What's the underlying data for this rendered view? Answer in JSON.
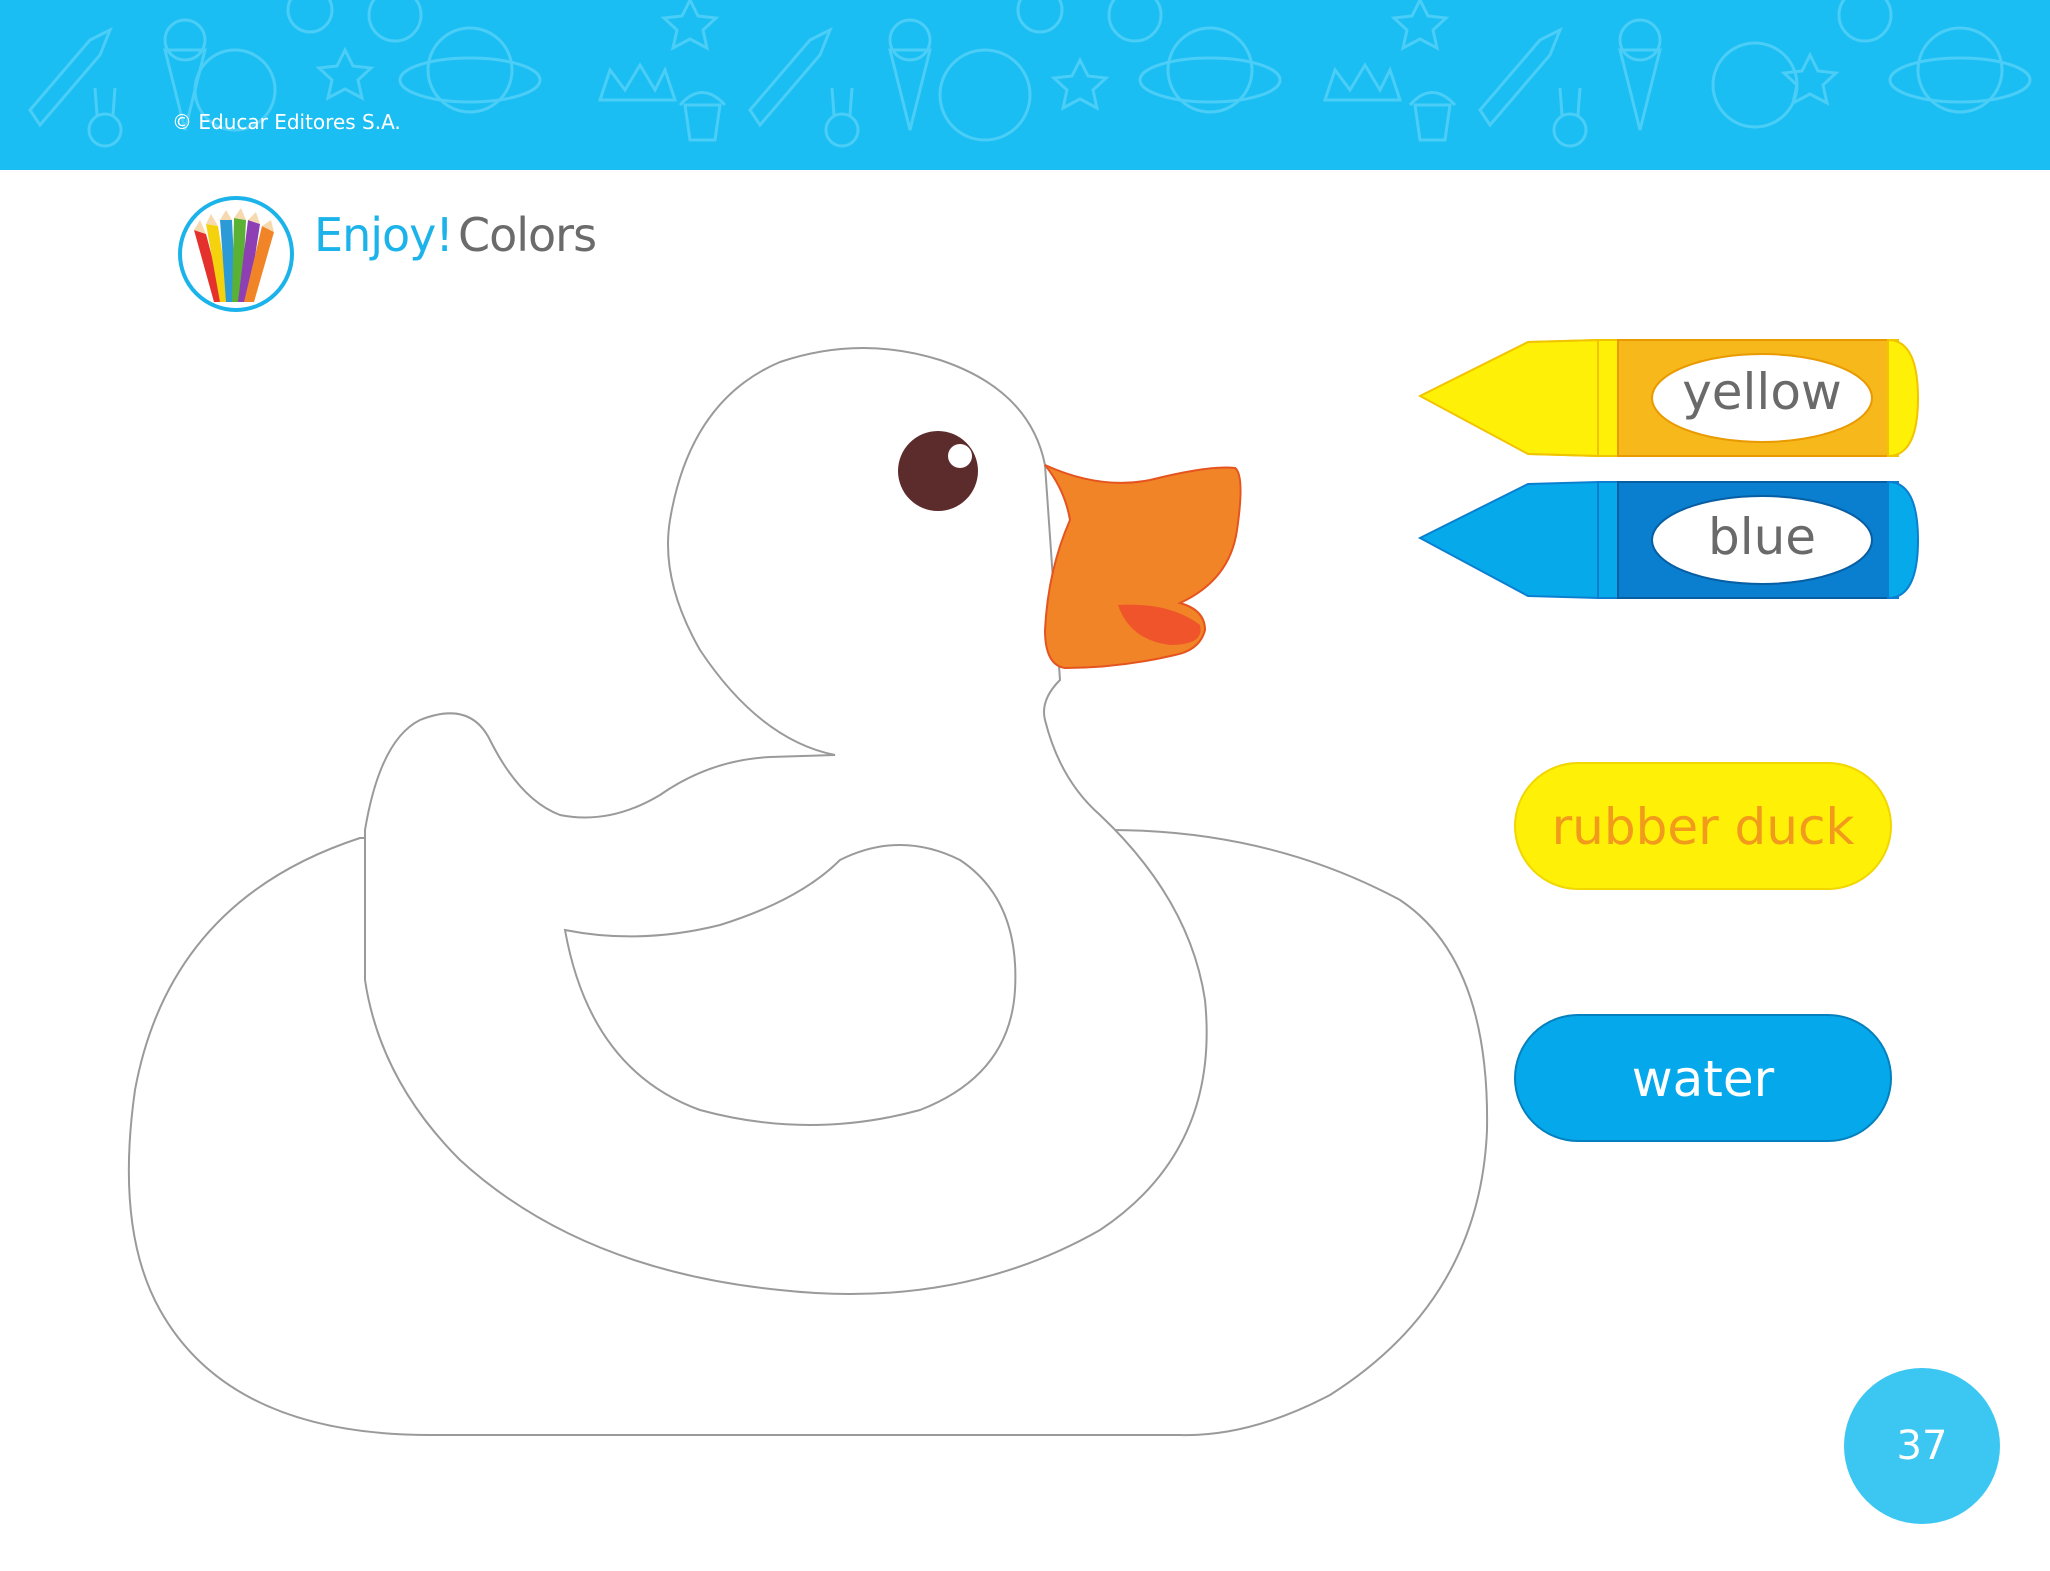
{
  "header": {
    "copyright": "© Educar Editores S.A."
  },
  "title": {
    "enjoy": "Enjoy!",
    "topic": "Colors"
  },
  "crayons": [
    {
      "label": "yellow",
      "color": "#fff007",
      "dark": "#f7b81c"
    },
    {
      "label": "blue",
      "color": "#06aaeb",
      "dark": "#0a7fd0"
    }
  ],
  "words": [
    {
      "label": "rubber duck",
      "color": "#fff007",
      "text_color": "#f19a1b"
    },
    {
      "label": "water",
      "color": "#05a8ea",
      "text_color": "#ffffff"
    }
  ],
  "page_number": "37",
  "colors": {
    "header_bg": "#1bbef2",
    "beak": "#f18427",
    "eye": "#5c2b2b"
  }
}
